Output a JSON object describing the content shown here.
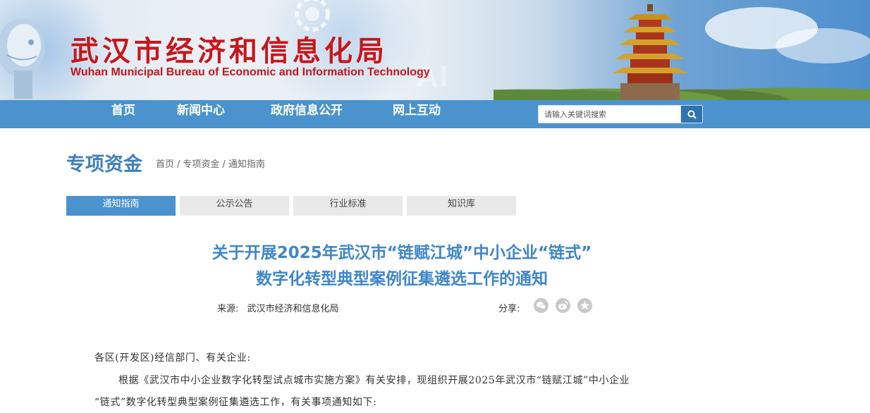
{
  "header": {
    "title_cn": "武汉市经济和信息化局",
    "title_en": "Wuhan Municipal Bureau of Economic and Information Technology",
    "decor_text": "AI"
  },
  "nav": {
    "items": [
      "首页",
      "新闻中心",
      "政府信息公开",
      "网上互动"
    ],
    "search_placeholder": "请输入关键词搜索"
  },
  "section": {
    "title": "专项资金",
    "breadcrumb": [
      "首页",
      "专项资金",
      "通知指南"
    ],
    "separator": "/"
  },
  "tabs": [
    {
      "label": "通知指南",
      "active": true
    },
    {
      "label": "公示公告",
      "active": false
    },
    {
      "label": "行业标准",
      "active": false
    },
    {
      "label": "知识库",
      "active": false
    }
  ],
  "article": {
    "title_line1": "关于开展2025年武汉市“链赋江城”中小企业“链式”",
    "title_line2": "数字化转型典型案例征集遴选工作的通知",
    "source_label": "来源:",
    "source": "武汉市经济和信息化局",
    "share_label": "分享:",
    "share_icons": [
      "wechat-icon",
      "weibo-icon",
      "qzone-icon"
    ],
    "salutation": "各区(开发区)经信部门、有关企业:",
    "para1_line1": "根据《武汉市中小企业数字化转型试点城市实施方案》有关安排，现组织开展2025年武汉市“链赋江城”中小企业",
    "para1_line2": "“链式”数字化转型典型案例征集遴选工作，有关事项通知如下:"
  },
  "colors": {
    "brand_red": "#c8161d",
    "nav_blue": "#4a93cf",
    "title_blue": "#3f86c8"
  }
}
